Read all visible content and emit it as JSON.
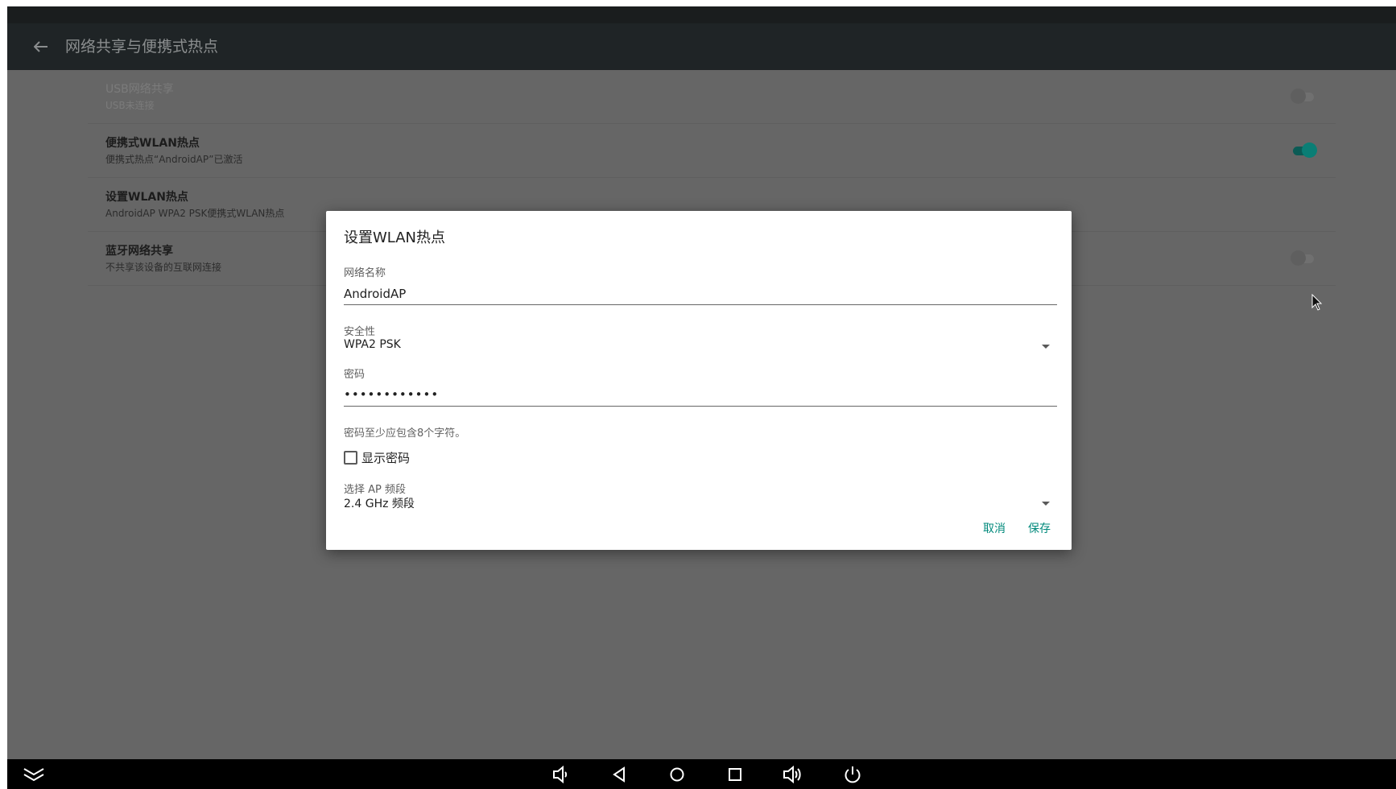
{
  "app_bar": {
    "title": "网络共享与便携式热点",
    "back_icon": "arrow-left-icon"
  },
  "preferences": [
    {
      "title": "USB网络共享",
      "summary": "USB未连接",
      "switch": "off",
      "enabled": false
    },
    {
      "title": "便携式WLAN热点",
      "summary": "便携式热点“AndroidAP”已激活",
      "switch": "on",
      "enabled": true
    },
    {
      "title": "设置WLAN热点",
      "summary": "AndroidAP WPA2 PSK便携式WLAN热点",
      "enabled": true
    },
    {
      "title": "蓝牙网络共享",
      "summary": "不共享该设备的互联网连接",
      "switch": "off",
      "enabled": true
    }
  ],
  "dialog": {
    "title": "设置WLAN热点",
    "network_name_label": "网络名称",
    "network_name_value": "AndroidAP",
    "security_label": "安全性",
    "security_value": "WPA2 PSK",
    "password_label": "密码",
    "password_value": "••••••••••••",
    "password_hint": "密码至少应包含8个字符。",
    "show_password_label": "显示密码",
    "show_password_checked": false,
    "ap_band_label": "选择 AP 频段",
    "ap_band_value": "2.4 GHz 频段",
    "cancel_label": "取消",
    "save_label": "保存"
  },
  "nav_bar": {
    "icons": [
      "collapse-chevrons-icon",
      "volume-down-icon",
      "back-triangle-icon",
      "home-circle-icon",
      "recents-square-icon",
      "volume-up-icon",
      "power-icon"
    ]
  },
  "colors": {
    "accent": "#00897b",
    "switch_on": "#0a7e75",
    "app_bar": "#1f2426",
    "scrim": "#666666"
  }
}
